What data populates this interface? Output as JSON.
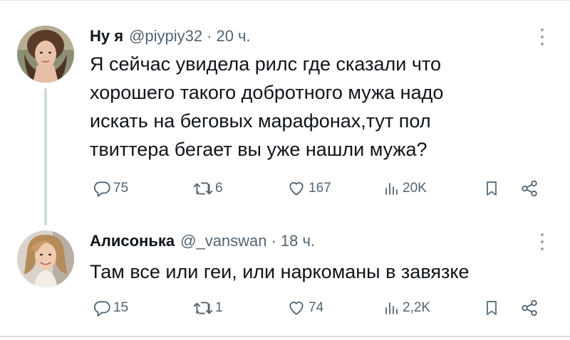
{
  "tweets": [
    {
      "name": "Ну я",
      "handle": "@piypiy32",
      "time": "20 ч.",
      "text": [
        "Я сейчас увидела рилс где сказали что",
        "хорошего такого добротного мужа надо",
        "искать на беговых марафонах,тут пол",
        "твиттера бегает вы уже нашли мужа?"
      ],
      "replies": "75",
      "retweets": "6",
      "likes": "167",
      "views": "20K"
    },
    {
      "name": "Алисонька",
      "handle": "@_vanswan",
      "time": "18 ч.",
      "text": [
        "Там все или геи, или наркоманы в завязке"
      ],
      "replies": "15",
      "retweets": "1",
      "likes": "74",
      "views": "2,2K"
    }
  ],
  "separator": "·",
  "icons": {
    "reply": "reply-icon",
    "retweet": "retweet-icon",
    "like": "heart-icon",
    "views": "views-icon",
    "bookmark": "bookmark-icon",
    "share": "share-icon",
    "more": "more-icon"
  }
}
